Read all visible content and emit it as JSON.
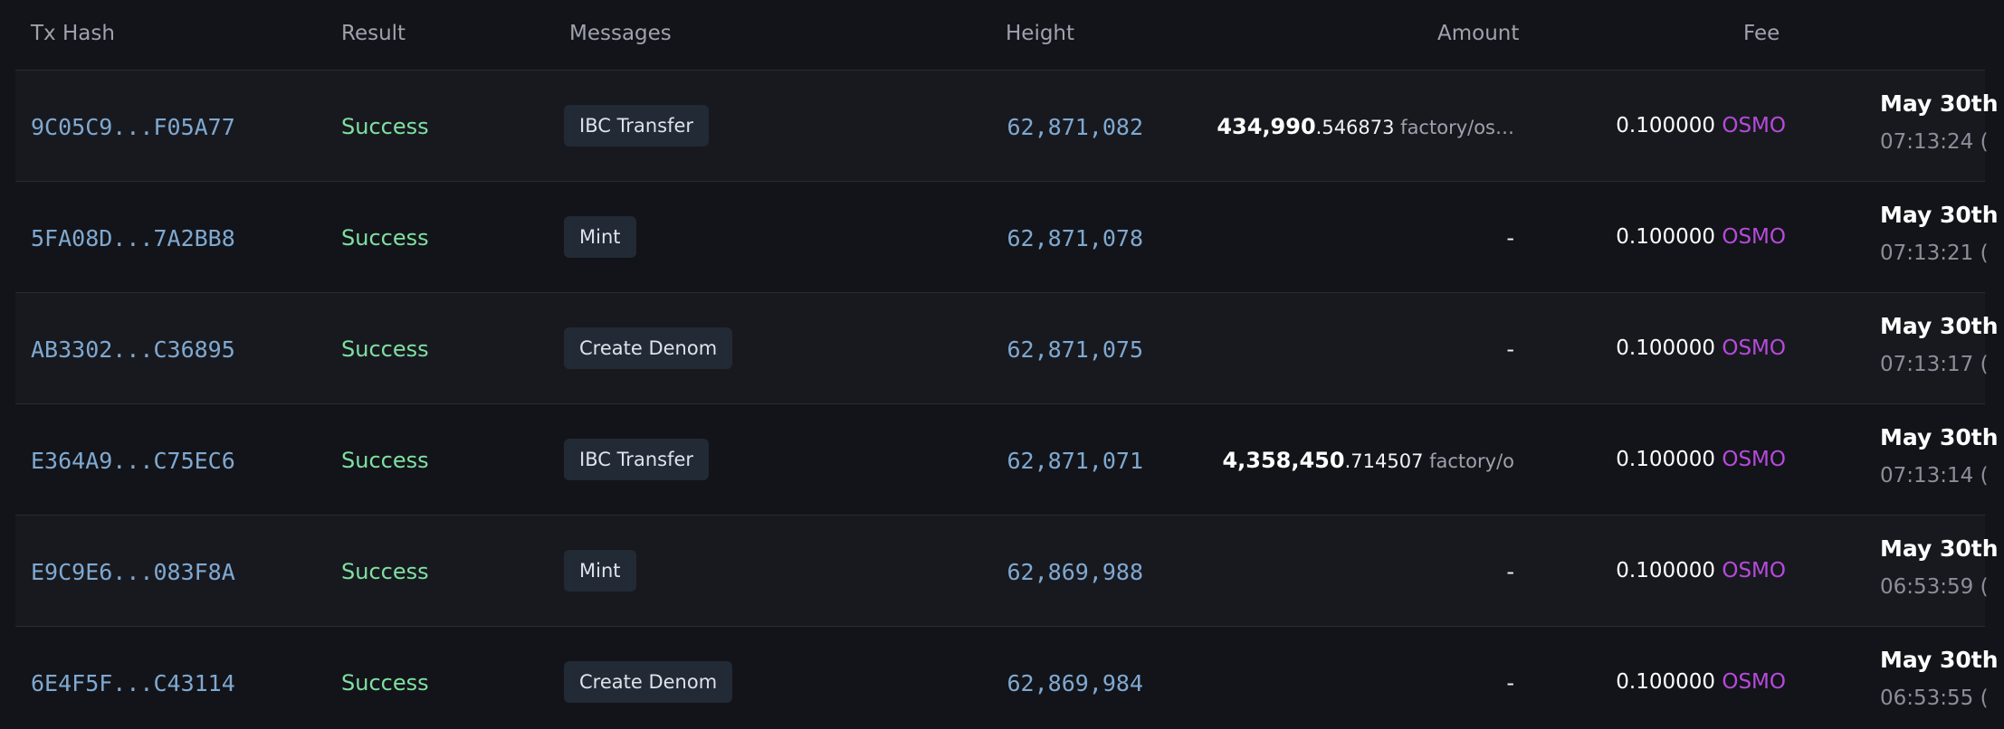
{
  "header": {
    "tx_hash": "Tx Hash",
    "result": "Result",
    "messages": "Messages",
    "height": "Height",
    "amount": "Amount",
    "fee": "Fee"
  },
  "rows": [
    {
      "hash": "9C05C9...F05A77",
      "result": "Success",
      "message": "IBC Transfer",
      "height": "62,871,082",
      "amount_int": "434,990",
      "amount_frac": ".546873",
      "amount_denom": " factory/os…",
      "amount_dash": "",
      "fee_value": "0.100000",
      "fee_denom": "OSMO",
      "date": "May 30th",
      "time": "07:13:24 ("
    },
    {
      "hash": "5FA08D...7A2BB8",
      "result": "Success",
      "message": "Mint",
      "height": "62,871,078",
      "amount_int": "",
      "amount_frac": "",
      "amount_denom": "",
      "amount_dash": "-",
      "fee_value": "0.100000",
      "fee_denom": "OSMO",
      "date": "May 30th",
      "time": "07:13:21 ("
    },
    {
      "hash": "AB3302...C36895",
      "result": "Success",
      "message": "Create Denom",
      "height": "62,871,075",
      "amount_int": "",
      "amount_frac": "",
      "amount_denom": "",
      "amount_dash": "-",
      "fee_value": "0.100000",
      "fee_denom": "OSMO",
      "date": "May 30th",
      "time": "07:13:17 ("
    },
    {
      "hash": "E364A9...C75EC6",
      "result": "Success",
      "message": "IBC Transfer",
      "height": "62,871,071",
      "amount_int": "4,358,450",
      "amount_frac": ".714507",
      "amount_denom": " factory/o",
      "amount_dash": "",
      "fee_value": "0.100000",
      "fee_denom": "OSMO",
      "date": "May 30th",
      "time": "07:13:14 ("
    },
    {
      "hash": "E9C9E6...083F8A",
      "result": "Success",
      "message": "Mint",
      "height": "62,869,988",
      "amount_int": "",
      "amount_frac": "",
      "amount_denom": "",
      "amount_dash": "-",
      "fee_value": "0.100000",
      "fee_denom": "OSMO",
      "date": "May 30th",
      "time": "06:53:59 ("
    },
    {
      "hash": "6E4F5F...C43114",
      "result": "Success",
      "message": "Create Denom",
      "height": "62,869,984",
      "amount_int": "",
      "amount_frac": "",
      "amount_denom": "",
      "amount_dash": "-",
      "fee_value": "0.100000",
      "fee_denom": "OSMO",
      "date": "May 30th",
      "time": "06:53:55 ("
    }
  ],
  "colors": {
    "background": "#131419",
    "hash_link": "#7fa9d1",
    "success": "#7fe0a2",
    "osmo": "#b54bdb",
    "badge": "#222a35"
  }
}
